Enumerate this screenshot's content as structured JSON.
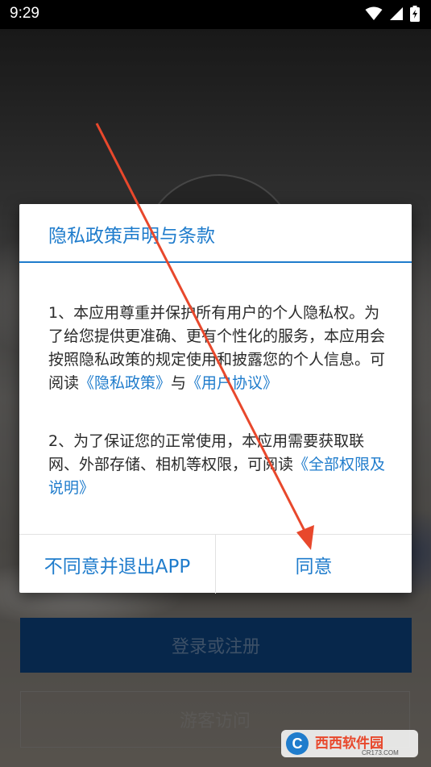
{
  "status_bar": {
    "time": "9:29",
    "icons": [
      "wifi-icon",
      "signal-icon",
      "battery-charging-icon"
    ]
  },
  "background": {
    "login_label": "登录或注册",
    "guest_label": "游客访问"
  },
  "dialog": {
    "title": "隐私政策声明与条款",
    "para1_text": "1、本应用尊重并保护所有用户的个人隐私权。为了给您提供更准确、更有个性化的服务，本应用会按照隐私政策的规定使用和披露您的个人信息。可阅读",
    "privacy_link": "《隐私政策》",
    "para1_and": "与",
    "user_agreement_link": "《用户协议》",
    "para2_text": "2、为了保证您的正常使用，本应用需要获取联网、外部存储、相机等权限，可阅读",
    "permissions_link": "《全部权限及说明》",
    "decline_label": "不同意并退出APP",
    "agree_label": "同意"
  },
  "watermark": {
    "brand": "西西软件园",
    "domain": "CR173.COM"
  },
  "colors": {
    "accent": "#1f7ccc",
    "annotation_arrow": "#e8482c",
    "login_button": "#0c3d74"
  }
}
